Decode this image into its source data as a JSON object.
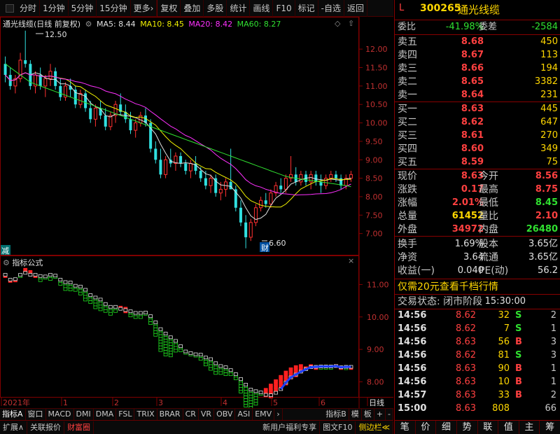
{
  "toolbar": {
    "items": [
      "分时",
      "1分钟",
      "5分钟",
      "15分钟",
      "更多›",
      "复权",
      "叠加",
      "多股",
      "统计",
      "画线",
      "F10",
      "标记",
      "-自选",
      "返回"
    ]
  },
  "main_chart": {
    "title": "通光线缆(日线 前复权)",
    "ma5": "MA5: 8.44",
    "ma10": "MA10: 8.45",
    "ma20": "MA20: 8.42",
    "ma60": "MA60: 8.27",
    "high_marker": "12.50",
    "low_marker": "6.60",
    "cai_badge": "财",
    "jian_badge": "减",
    "y_ticks": [
      "12.00",
      "11.50",
      "11.00",
      "10.50",
      "10.00",
      "9.50",
      "9.00",
      "8.50",
      "8.00",
      "7.50",
      "7.00"
    ],
    "colors": {
      "up": "#ff3030",
      "down": "#30e0e0",
      "ma5": "#e0e0e0",
      "ma10": "#f0f000",
      "ma20": "#ff30ff",
      "ma60": "#30e030"
    }
  },
  "chart_data": {
    "type": "candlestick",
    "x_labels": [
      "2021年",
      "1",
      "2",
      "3",
      "4",
      "5",
      "6",
      "日线"
    ],
    "ylim": [
      6.5,
      12.8
    ],
    "candles": [
      [
        11.6,
        11.8,
        11.1,
        11.3
      ],
      [
        11.3,
        11.5,
        10.9,
        11.0
      ],
      [
        11.0,
        11.3,
        10.8,
        11.2
      ],
      [
        11.2,
        11.9,
        11.1,
        11.7
      ],
      [
        11.7,
        12.5,
        11.5,
        11.6
      ],
      [
        11.6,
        11.7,
        10.9,
        11.0
      ],
      [
        11.0,
        11.4,
        10.8,
        11.3
      ],
      [
        11.3,
        11.5,
        10.9,
        11.0
      ],
      [
        11.0,
        11.3,
        10.7,
        11.2
      ],
      [
        11.2,
        11.6,
        11.0,
        11.4
      ],
      [
        11.4,
        11.5,
        10.9,
        11.0
      ],
      [
        11.0,
        11.2,
        10.6,
        10.7
      ],
      [
        10.7,
        11.1,
        10.6,
        11.0
      ],
      [
        11.0,
        11.2,
        10.7,
        10.9
      ],
      [
        10.9,
        11.0,
        10.4,
        10.5
      ],
      [
        10.5,
        10.9,
        10.4,
        10.8
      ],
      [
        10.8,
        10.9,
        10.3,
        10.4
      ],
      [
        10.4,
        10.6,
        10.0,
        10.1
      ],
      [
        10.1,
        10.5,
        9.9,
        10.4
      ],
      [
        10.4,
        10.6,
        10.1,
        10.2
      ],
      [
        10.2,
        10.4,
        9.8,
        9.9
      ],
      [
        9.9,
        10.3,
        9.8,
        10.2
      ],
      [
        10.2,
        10.6,
        10.0,
        10.5
      ],
      [
        10.5,
        10.8,
        10.2,
        10.3
      ],
      [
        10.3,
        10.5,
        10.0,
        10.1
      ],
      [
        10.1,
        10.3,
        9.7,
        9.8
      ],
      [
        9.8,
        10.1,
        9.6,
        10.0
      ],
      [
        10.0,
        10.3,
        9.9,
        10.2
      ],
      [
        10.2,
        10.4,
        9.9,
        10.0
      ],
      [
        10.0,
        10.1,
        9.2,
        9.3
      ],
      [
        9.3,
        9.5,
        8.9,
        9.0
      ],
      [
        9.0,
        9.3,
        8.5,
        8.6
      ],
      [
        8.6,
        9.1,
        8.5,
        9.0
      ],
      [
        9.0,
        9.3,
        8.8,
        8.9
      ],
      [
        8.9,
        9.2,
        8.7,
        9.1
      ],
      [
        9.1,
        9.2,
        8.8,
        8.9
      ],
      [
        8.9,
        9.0,
        8.6,
        8.7
      ],
      [
        8.7,
        9.0,
        8.5,
        8.9
      ],
      [
        8.9,
        9.1,
        8.6,
        8.7
      ],
      [
        8.7,
        8.8,
        8.4,
        8.5
      ],
      [
        8.5,
        8.7,
        8.2,
        8.3
      ],
      [
        8.3,
        8.6,
        8.1,
        8.5
      ],
      [
        8.5,
        8.6,
        8.0,
        8.1
      ],
      [
        8.1,
        8.4,
        7.9,
        8.2
      ],
      [
        8.2,
        8.5,
        8.0,
        8.4
      ],
      [
        8.4,
        9.3,
        8.3,
        8.2
      ],
      [
        8.2,
        8.3,
        7.6,
        7.7
      ],
      [
        7.7,
        7.9,
        7.2,
        7.3
      ],
      [
        7.3,
        7.5,
        6.6,
        6.9
      ],
      [
        6.9,
        7.4,
        6.8,
        7.3
      ],
      [
        7.3,
        7.8,
        7.2,
        7.7
      ],
      [
        7.7,
        8.0,
        7.6,
        7.9
      ],
      [
        7.9,
        8.1,
        7.7,
        7.8
      ],
      [
        7.8,
        8.2,
        7.7,
        8.1
      ],
      [
        8.1,
        8.4,
        8.0,
        8.3
      ],
      [
        8.3,
        8.5,
        8.1,
        8.2
      ],
      [
        8.2,
        8.6,
        8.1,
        8.5
      ],
      [
        8.5,
        9.1,
        8.4,
        8.6
      ],
      [
        8.6,
        8.8,
        8.3,
        8.4
      ],
      [
        8.4,
        8.7,
        8.3,
        8.6
      ],
      [
        8.6,
        8.7,
        8.3,
        8.4
      ],
      [
        8.4,
        8.7,
        8.2,
        8.6
      ],
      [
        8.6,
        8.7,
        8.3,
        8.4
      ],
      [
        8.4,
        8.6,
        8.1,
        8.3
      ],
      [
        8.3,
        8.6,
        8.2,
        8.5
      ],
      [
        8.5,
        8.7,
        8.4,
        8.6
      ],
      [
        8.6,
        8.7,
        8.4,
        8.5
      ],
      [
        8.5,
        8.6,
        8.2,
        8.3
      ],
      [
        8.3,
        8.6,
        8.2,
        8.5
      ],
      [
        8.5,
        8.7,
        8.4,
        8.6
      ]
    ],
    "ma60": [
      11.6,
      11.5,
      11.4,
      11.3,
      11.2,
      11.1,
      11.05,
      11.0,
      10.95,
      10.9,
      10.85,
      10.8,
      10.75,
      10.7,
      10.65,
      10.6,
      10.55,
      10.5,
      10.45,
      10.4,
      10.35,
      10.3,
      10.25,
      10.2,
      10.15,
      10.1,
      10.05,
      10.0,
      9.95,
      9.9,
      9.85,
      9.8,
      9.75,
      9.7,
      9.65,
      9.6,
      9.55,
      9.5,
      9.45,
      9.4,
      9.35,
      9.3,
      9.25,
      9.2,
      9.15,
      9.1,
      9.05,
      9.0,
      8.95,
      8.9,
      8.85,
      8.8,
      8.75,
      8.7,
      8.65,
      8.6,
      8.55,
      8.52,
      8.5,
      8.48,
      8.46,
      8.44,
      8.42,
      8.4,
      8.38,
      8.36,
      8.34,
      8.32,
      8.3,
      8.27
    ]
  },
  "indicator": {
    "title": "指标公式",
    "y_ticks": [
      "11.00",
      "10.00",
      "9.00",
      "8.00"
    ],
    "ylim": [
      7.6,
      11.7
    ]
  },
  "tabs_row1": [
    "指标A",
    "窗口",
    "MACD",
    "DMI",
    "DMA",
    "FSL",
    "TRIX",
    "BRAR",
    "CR",
    "VR",
    "OBV",
    "ASI",
    "EMV",
    "›",
    "指标B",
    "模",
    "板",
    "+",
    "-"
  ],
  "tabs_row2": {
    "left": [
      "扩展∧",
      "关联报价",
      "财富圈"
    ],
    "right": [
      "新用户福利专享",
      "图文F10",
      "侧边栏≪"
    ]
  },
  "quote": {
    "marker": "L",
    "code": "300265",
    "name": "通光线缆",
    "weibi_label": "委比",
    "weibi": "-41.98%",
    "weicha_label": "委差",
    "weicha": "-2584",
    "asks": [
      {
        "label": "卖五",
        "price": "8.68",
        "vol": "450"
      },
      {
        "label": "卖四",
        "price": "8.67",
        "vol": "113"
      },
      {
        "label": "卖三",
        "price": "8.66",
        "vol": "194"
      },
      {
        "label": "卖二",
        "price": "8.65",
        "vol": "3382"
      },
      {
        "label": "卖一",
        "price": "8.64",
        "vol": "231"
      }
    ],
    "bids": [
      {
        "label": "买一",
        "price": "8.63",
        "vol": "445"
      },
      {
        "label": "买二",
        "price": "8.62",
        "vol": "647"
      },
      {
        "label": "买三",
        "price": "8.61",
        "vol": "270"
      },
      {
        "label": "买四",
        "price": "8.60",
        "vol": "349"
      },
      {
        "label": "买五",
        "price": "8.59",
        "vol": "75"
      }
    ],
    "stats": [
      {
        "l1": "现价",
        "v1": "8.63",
        "c1": "red",
        "l2": "今开",
        "v2": "8.56",
        "c2": "red"
      },
      {
        "l1": "涨跌",
        "v1": "0.17",
        "c1": "red",
        "l2": "最高",
        "v2": "8.75",
        "c2": "red"
      },
      {
        "l1": "涨幅",
        "v1": "2.01%",
        "c1": "red",
        "l2": "最低",
        "v2": "8.45",
        "c2": "green"
      },
      {
        "l1": "总量",
        "v1": "61452",
        "c1": "yellow",
        "l2": "量比",
        "v2": "2.10",
        "c2": "red"
      },
      {
        "l1": "外盘",
        "v1": "34972",
        "c1": "red",
        "l2": "内盘",
        "v2": "26480",
        "c2": "green"
      }
    ],
    "fin": [
      {
        "l1": "换手",
        "v1": "1.69%",
        "l2": "股本",
        "v2": "3.65亿"
      },
      {
        "l1": "净资",
        "v1": "3.64",
        "l2": "流通",
        "v2": "3.65亿"
      },
      {
        "l1": "收益(一)",
        "v1": "0.040",
        "l2": "PE(动)",
        "v2": "56.2"
      }
    ],
    "promo": "仅需20元查看千档行情",
    "status_label": "交易状态: 闭市阶段",
    "status_time": "15:30:00",
    "ticks": [
      {
        "t": "14:56",
        "p": "8.62",
        "v": "32",
        "s": "S",
        "n": "2"
      },
      {
        "t": "14:56",
        "p": "8.62",
        "v": "7",
        "s": "S",
        "n": "1"
      },
      {
        "t": "14:56",
        "p": "8.63",
        "v": "56",
        "s": "B",
        "n": "3"
      },
      {
        "t": "14:56",
        "p": "8.62",
        "v": "81",
        "s": "S",
        "n": "3"
      },
      {
        "t": "14:56",
        "p": "8.63",
        "v": "90",
        "s": "B",
        "n": "1"
      },
      {
        "t": "14:56",
        "p": "8.63",
        "v": "10",
        "s": "B",
        "n": "1"
      },
      {
        "t": "14:57",
        "p": "8.63",
        "v": "33",
        "s": "B",
        "n": "2"
      },
      {
        "t": "15:00",
        "p": "8.63",
        "v": "808",
        "s": "",
        "n": "66"
      }
    ],
    "bottom_tabs": [
      "笔",
      "价",
      "细",
      "势",
      "联",
      "值",
      "主",
      "筹"
    ]
  }
}
